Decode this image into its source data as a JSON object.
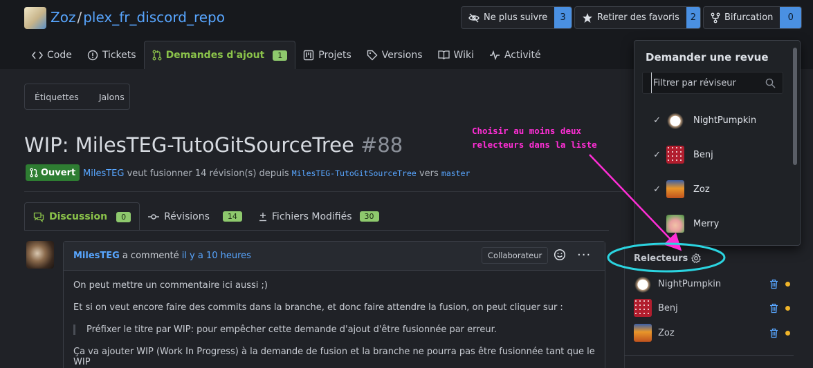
{
  "header": {
    "owner": "Zoz",
    "separator": "/",
    "repo": "plex_fr_discord_repo",
    "buttons": [
      {
        "label": "Ne plus suivre",
        "count": "3",
        "icon": "eye-slash-icon"
      },
      {
        "label": "Retirer des favoris",
        "count": "2",
        "icon": "star-icon"
      },
      {
        "label": "Bifurcation",
        "count": "0",
        "icon": "fork-icon"
      }
    ]
  },
  "tabs": [
    {
      "label": "Code",
      "icon": "code-icon"
    },
    {
      "label": "Tickets",
      "icon": "issue-icon"
    },
    {
      "label": "Demandes d'ajout",
      "icon": "pull-request-icon",
      "badge": "1"
    },
    {
      "label": "Projets",
      "icon": "project-icon"
    },
    {
      "label": "Versions",
      "icon": "tag-icon"
    },
    {
      "label": "Wiki",
      "icon": "book-icon"
    },
    {
      "label": "Activité",
      "icon": "pulse-icon"
    }
  ],
  "filters": {
    "labels": "Étiquettes",
    "milestones": "Jalons"
  },
  "pr": {
    "title": "WIP: MilesTEG-TutoGitSourceTree",
    "number": "#88",
    "status": "Ouvert",
    "author": "MilesTEG",
    "text_merge": "veut fusionner 14 révision(s) depuis",
    "source_branch": "MilesTEG-TutoGitSourceTree",
    "text_into": "vers",
    "target_branch": "master"
  },
  "content_tabs": [
    {
      "label": "Discussion",
      "count": "0",
      "icon": "comment-icon"
    },
    {
      "label": "Révisions",
      "count": "14",
      "icon": "commit-icon"
    },
    {
      "label": "Fichiers Modifiés",
      "count": "30",
      "icon": "diff-icon"
    }
  ],
  "comment": {
    "author": "MilesTEG",
    "action": "a commenté",
    "time": "il y a 10 heures",
    "role": "Collaborateur",
    "more": "···",
    "paragraphs": [
      "On peut mettre un commentaire ici aussi ;)",
      "Et si on veut encore faire des commits dans la branche, et donc faire attendre la fusion, on peut cliquer sur :"
    ],
    "quote": "Préfixer le titre par WIP: pour empêcher cette demande d'ajout d'être fusionnée par erreur.",
    "paragraph3": "Ça va ajouter WIP (Work In Progress) à la demande de fusion et la branche ne pourra pas être fusionnée tant que le WIP"
  },
  "annotation": {
    "line1": "Choisir au moins deux",
    "line2": "relecteurs dans la liste",
    "color": "#ff2ed6",
    "ellipse_color": "#2bd4e0"
  },
  "review_popup": {
    "title": "Demander une revue",
    "search_placeholder": "Filtrer par réviseur",
    "items": [
      {
        "name": "NightPumpkin",
        "checked": "✓"
      },
      {
        "name": "Benj",
        "checked": "✓"
      },
      {
        "name": "Zoz",
        "checked": "✓"
      },
      {
        "name": "Merry",
        "checked": ""
      }
    ]
  },
  "sidebar": {
    "reviewers_title": "Relecteurs",
    "reviewers": [
      {
        "name": "NightPumpkin"
      },
      {
        "name": "Benj"
      },
      {
        "name": "Zoz"
      }
    ],
    "status_color": "#f0b429"
  }
}
